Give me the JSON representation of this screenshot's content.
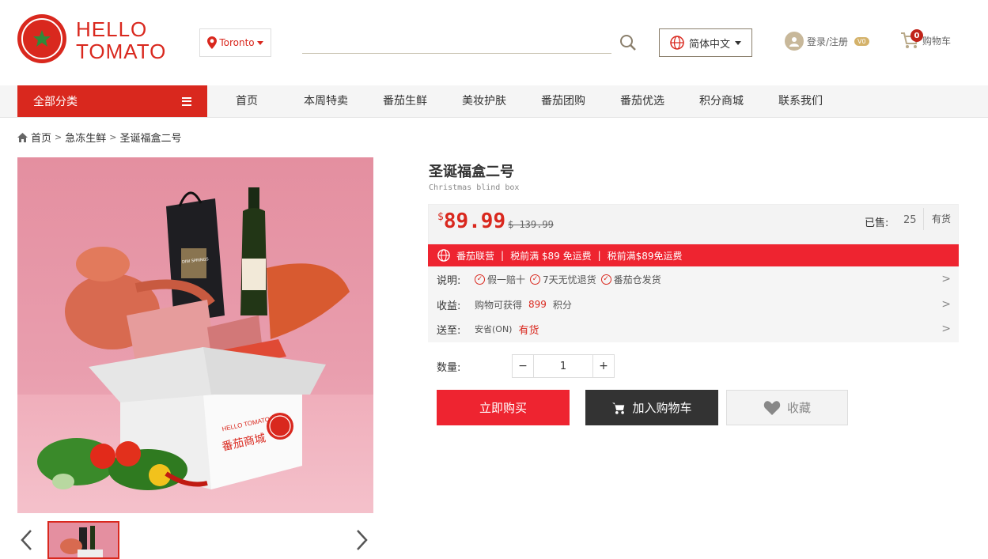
{
  "header": {
    "logo_line1": "HELLO",
    "logo_line2": "TOMATO",
    "location": "Toronto",
    "language": "简体中文",
    "login_label": "登录/注册",
    "vip_level": "V0",
    "cart_count": "0",
    "cart_label": "购物车"
  },
  "nav": {
    "all_categories": "全部分类",
    "items": [
      "首页",
      "本周特卖",
      "番茄生鲜",
      "美妆护肤",
      "番茄团购",
      "番茄优选",
      "积分商城",
      "联系我们"
    ]
  },
  "breadcrumb": [
    "首页",
    "急冻生鲜",
    "圣诞福盒二号"
  ],
  "product": {
    "title": "圣诞福盒二号",
    "subtitle": "Christmas blind box",
    "currency": "$",
    "price": "89.99",
    "old_price": "$ 139.99",
    "sold_label": "已售:",
    "sold_count": "25",
    "stock_status": "有货",
    "promo": [
      "番茄联营",
      "|",
      "税前满 $89 免运费",
      "|",
      "税前满$89免运费"
    ],
    "desc_label": "说明:",
    "desc_items": [
      "假一赔十",
      "7天无忧退货",
      "番茄仓发货"
    ],
    "points_label": "收益:",
    "points_prefix": "购物可获得",
    "points_value": "899",
    "points_suffix": "积分",
    "ship_label": "送至:",
    "ship_region": "安省(ON)",
    "ship_status": "有货",
    "qty_label": "数量:",
    "qty_value": "1",
    "buy_now": "立即购买",
    "add_cart": "加入购物车",
    "favorite": "收藏",
    "box_text_en": "HELLO TOMATO",
    "box_text_cn": "番茄商城",
    "wine_brand": "DIW SPRINGS"
  },
  "colors": {
    "brand_red": "#d9281e",
    "promo_red": "#ee2430",
    "dark_button": "#333333",
    "image_bg": "#e48fa0"
  },
  "icons": [
    "location-pin-icon",
    "caret-down-icon",
    "search-icon",
    "globe-icon",
    "user-avatar-icon",
    "cart-icon",
    "menu-icon",
    "home-icon",
    "chevron-right-icon",
    "check-circle-icon",
    "heart-icon",
    "chevron-left-icon"
  ]
}
